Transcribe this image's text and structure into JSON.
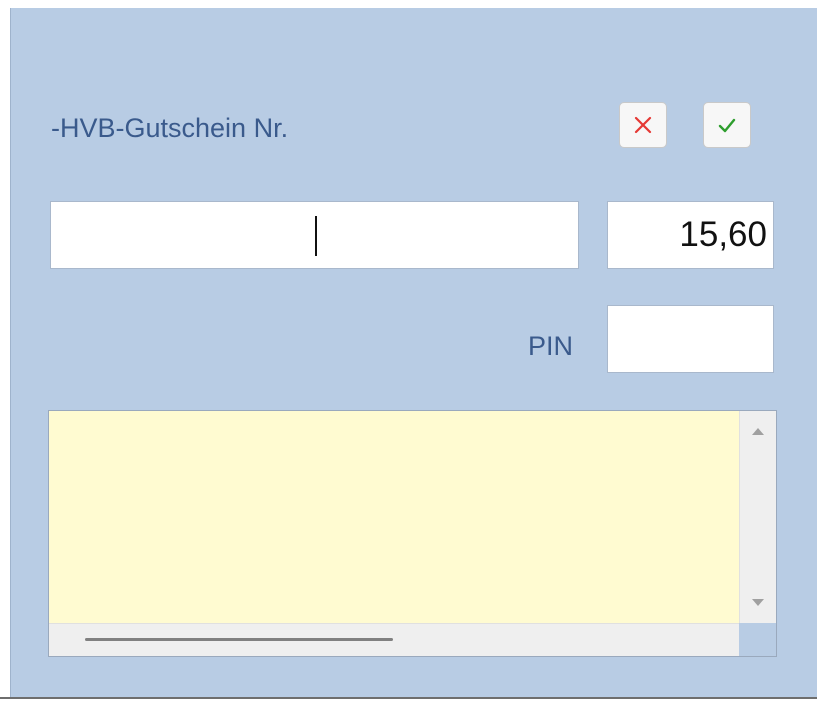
{
  "dialog": {
    "title": "-HVB-Gutschein Nr.",
    "cancel_icon": "close-x-icon",
    "confirm_icon": "checkmark-icon"
  },
  "voucher": {
    "number_value": "",
    "amount_value": "15,60"
  },
  "pin": {
    "label": "PIN",
    "value": ""
  },
  "memo": {
    "text": ""
  },
  "colors": {
    "panel_background": "#b8cce4",
    "label_text": "#3a5a8c",
    "memo_background": "#fffbd1",
    "cancel_icon": "#e53935",
    "confirm_icon": "#2e9e2e"
  }
}
